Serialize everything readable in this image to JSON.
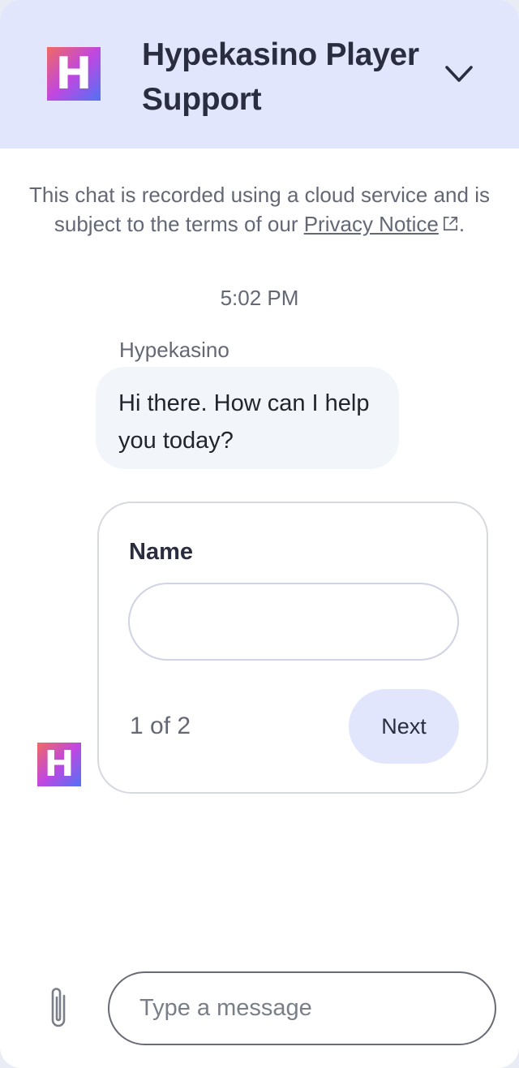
{
  "header": {
    "logo_letter": "H",
    "title": "Hypekasino Player Support",
    "collapse_icon": "chevron-down-icon"
  },
  "notice": {
    "text": "This chat is recorded using a cloud service and is subject to the terms of our ",
    "link_label": "Privacy Notice",
    "link_icon": "external-link-icon",
    "trailing": "."
  },
  "conversation": {
    "timestamp": "5:02 PM",
    "sender_name": "Hypekasino",
    "message": "Hi there. How can I help you today?",
    "avatar_letter": "H"
  },
  "form": {
    "field_label": "Name",
    "field_value": "",
    "page_indicator": "1 of 2",
    "next_label": "Next"
  },
  "composer": {
    "attach_icon": "paperclip-icon",
    "placeholder": "Type a message"
  },
  "colors": {
    "header_bg": "#e1e6fc",
    "bubble_bg": "#f2f5f9",
    "button_bg": "#e1e6fc",
    "text_dark": "#2a2d3f",
    "text_muted": "#646876"
  }
}
